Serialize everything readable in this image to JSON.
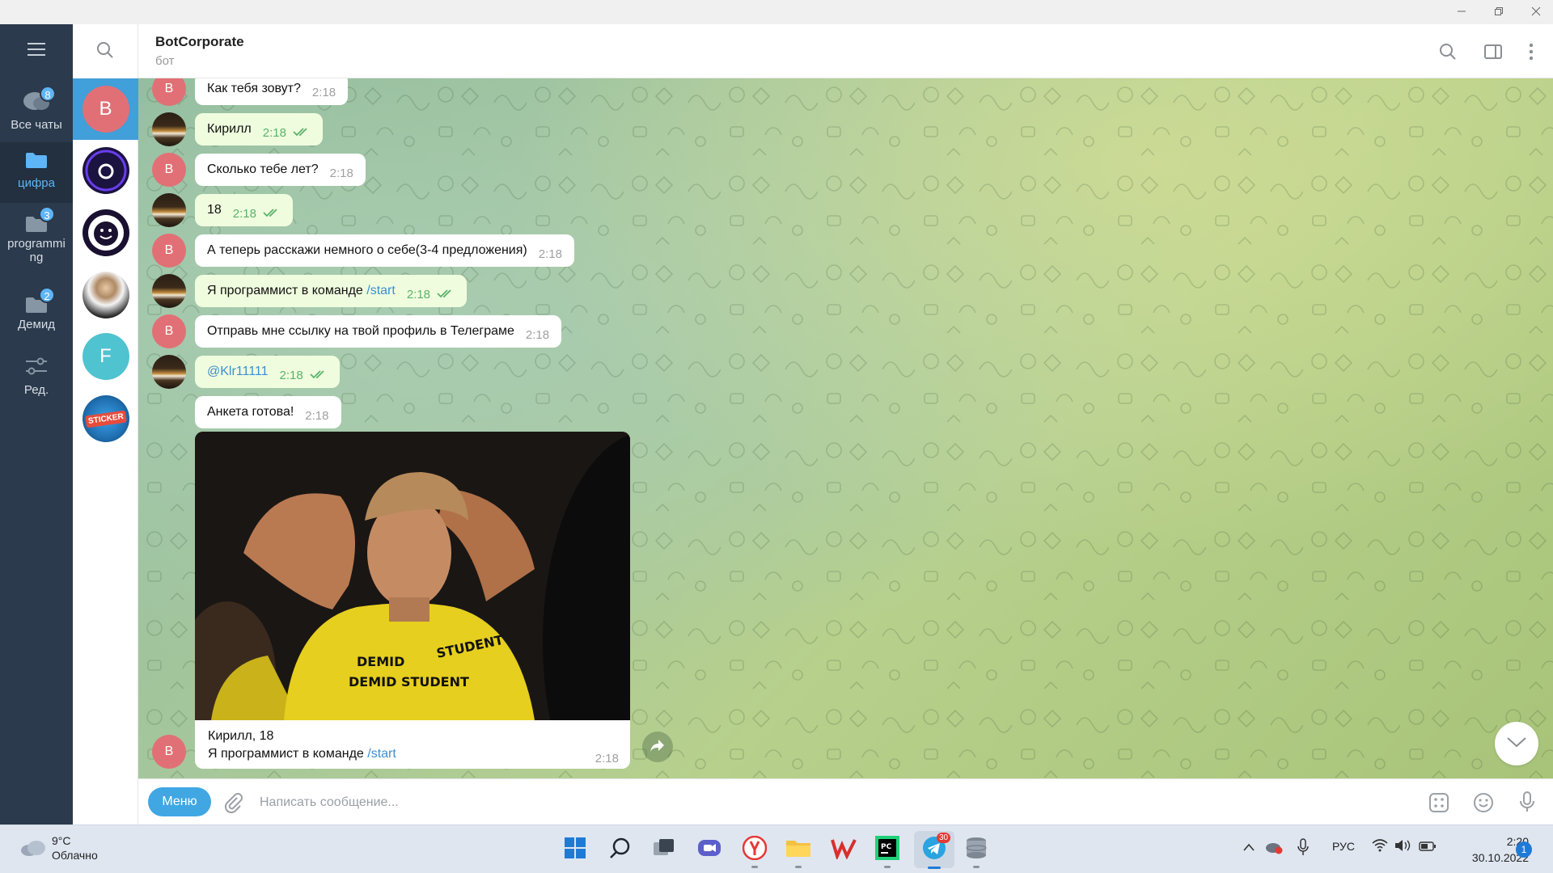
{
  "window": {
    "minimize_icon": "minimize-icon",
    "restore_icon": "restore-icon",
    "close_icon": "close-icon"
  },
  "folders": [
    {
      "label": "Все чаты",
      "badge": "8",
      "icon": "chat-bubbles-icon"
    },
    {
      "label": "цифра",
      "badge": "",
      "icon": "folder-icon",
      "active": true
    },
    {
      "label": "programming",
      "badge": "3",
      "icon": "folder-icon"
    },
    {
      "label": "Демид",
      "badge": "2",
      "icon": "folder-icon"
    },
    {
      "label": "Ред.",
      "badge": "",
      "icon": "sliders-icon"
    }
  ],
  "chat_list": [
    {
      "letter": "B",
      "color": "#e17076",
      "active": true
    },
    {
      "letter": "",
      "color": "#1b1340"
    },
    {
      "letter": "",
      "color": "#1a1030"
    },
    {
      "letter": "",
      "color": "#cfd6dc"
    },
    {
      "letter": "F",
      "color": "#4fc3cf"
    },
    {
      "letter": "",
      "color": "#1f6fb0",
      "sticker": "STICKER"
    }
  ],
  "header": {
    "title": "BotCorporate",
    "subtitle": "бот"
  },
  "messages": [
    {
      "dir": "in",
      "text": "Как тебя зовут?",
      "time": "2:18",
      "avatar": "B"
    },
    {
      "dir": "out",
      "text": "Кирилл",
      "time": "2:18"
    },
    {
      "dir": "in",
      "text": "Сколько тебе лет?",
      "time": "2:18",
      "avatar": "B"
    },
    {
      "dir": "out",
      "text": "18",
      "time": "2:18"
    },
    {
      "dir": "in",
      "text": "А теперь расскажи немного о себе(3-4 предложения)",
      "time": "2:18",
      "avatar": "B"
    },
    {
      "dir": "out",
      "text": "Я программист в команде ",
      "link": "/start",
      "time": "2:18"
    },
    {
      "dir": "in",
      "text": "Отправь мне ссылку на твой профиль в Телеграме",
      "time": "2:18",
      "avatar": "B"
    },
    {
      "dir": "out",
      "text": "",
      "link": "@Klr11111",
      "time": "2:18"
    },
    {
      "dir": "in",
      "text": "Анкета готова!",
      "time": "2:18"
    }
  ],
  "photo_message": {
    "caption_line1": "Кирилл, 18",
    "caption_line2": "Я программист в команде ",
    "caption_link": "/start",
    "time": "2:18",
    "avatar": "B",
    "shirt_text": [
      "DEMID",
      "STUDENT",
      "DEMID STUDENT"
    ]
  },
  "input": {
    "menu_label": "Меню",
    "placeholder": "Написать сообщение..."
  },
  "taskbar": {
    "temperature": "9°C",
    "weather": "Облачно",
    "telegram_badge": "30",
    "language": "РУС",
    "time": "2:20",
    "date": "30.10.2022",
    "notification_count": "1"
  }
}
